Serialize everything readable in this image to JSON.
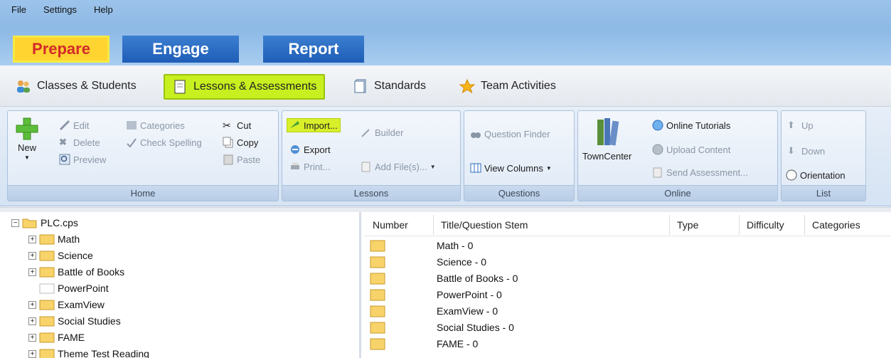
{
  "menu": {
    "file": "File",
    "settings": "Settings",
    "help": "Help"
  },
  "main_tabs": {
    "prepare": "Prepare",
    "engage": "Engage",
    "report": "Report"
  },
  "subnav": {
    "classes": "Classes & Students",
    "lessons": "Lessons & Assessments",
    "standards": "Standards",
    "team": "Team Activities"
  },
  "ribbon": {
    "home": {
      "footer": "Home",
      "new": "New",
      "edit": "Edit",
      "delete": "Delete",
      "preview": "Preview",
      "categories": "Categories",
      "check_spelling": "Check Spelling",
      "cut": "Cut",
      "copy": "Copy",
      "paste": "Paste"
    },
    "lessons": {
      "footer": "Lessons",
      "import": "Import...",
      "builder": "Builder",
      "export": "Export",
      "add_files": "Add File(s)...",
      "print": "Print..."
    },
    "questions": {
      "footer": "Questions",
      "question_finder": "Question Finder",
      "view_columns": "View Columns"
    },
    "online": {
      "footer": "Online",
      "towncenter": "TownCenter",
      "online_tutorials": "Online Tutorials",
      "upload_content": "Upload Content",
      "send_assessment": "Send Assessment..."
    },
    "list": {
      "footer": "List",
      "up": "Up",
      "down": "Down",
      "orientation": "Orientation"
    }
  },
  "tree": {
    "root": "PLC.cps",
    "items": [
      "Math",
      "Science",
      "Battle of Books",
      "PowerPoint",
      "ExamView",
      "Social Studies",
      "FAME",
      "Theme Test Reading"
    ]
  },
  "table": {
    "headers": {
      "number": "Number",
      "title": "Title/Question Stem",
      "type": "Type",
      "difficulty": "Difficulty",
      "categories": "Categories"
    },
    "rows": [
      "Math - 0",
      "Science - 0",
      "Battle of Books - 0",
      "PowerPoint - 0",
      "ExamView - 0",
      "Social Studies - 0",
      "FAME - 0"
    ]
  },
  "colors": {
    "highlight": "#c8ef1f",
    "prepare_tab": "#ffd330",
    "tab_blue": "#1f5db7",
    "folder": "#f7d36a"
  }
}
